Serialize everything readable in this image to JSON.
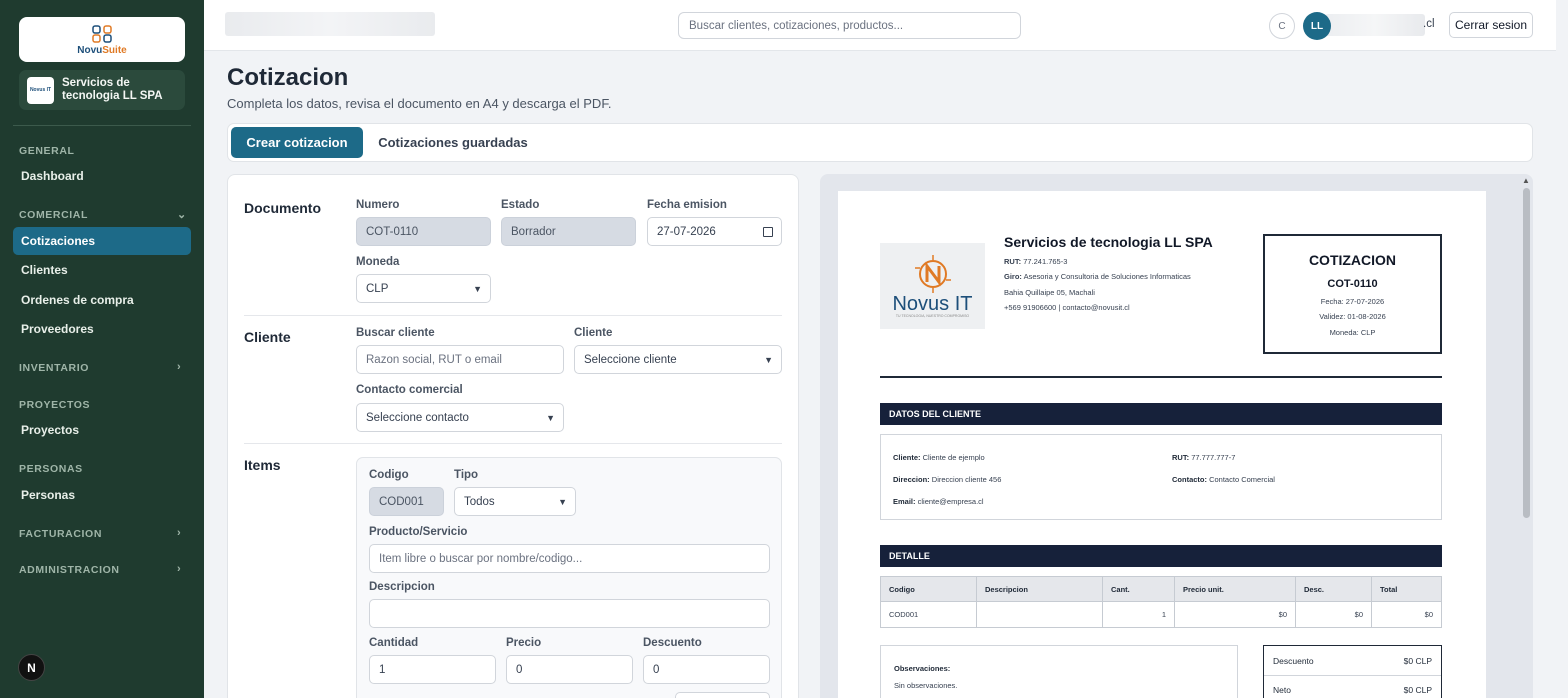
{
  "sidebar": {
    "brand": {
      "name_main": "Novu",
      "name_accent": "Suite"
    },
    "company": {
      "logo_text": "Novus IT",
      "name": "Servicios de tecnologia LL SPA"
    },
    "sections": [
      {
        "label": "GENERAL"
      },
      {
        "label": "COMERCIAL"
      },
      {
        "label": "INVENTARIO"
      },
      {
        "label": "PROYECTOS"
      },
      {
        "label": "PERSONAS"
      },
      {
        "label": "FACTURACION"
      },
      {
        "label": "ADMINISTRACION"
      }
    ],
    "items": {
      "dashboard": "Dashboard",
      "cotizaciones": "Cotizaciones",
      "clientes": "Clientes",
      "ordenes": "Ordenes de compra",
      "proveedores": "Proveedores",
      "proyectos": "Proyectos",
      "personas": "Personas"
    },
    "next_badge": "N"
  },
  "topbar": {
    "search_placeholder": "Buscar clientes, cotizaciones, productos...",
    "theme_btn": "C",
    "avatar": "LL",
    "user_suffix": ".cl",
    "logout": "Cerrar sesion"
  },
  "page": {
    "title": "Cotizacion",
    "subtitle": "Completa los datos, revisa el documento en A4 y descarga el PDF.",
    "tabs": {
      "create": "Crear cotizacion",
      "saved": "Cotizaciones guardadas"
    }
  },
  "form": {
    "documento": {
      "section": "Documento",
      "numero_label": "Numero",
      "numero_value": "COT-0110",
      "estado_label": "Estado",
      "estado_value": "Borrador",
      "fecha_label": "Fecha emision",
      "fecha_value": "27-07-2026",
      "moneda_label": "Moneda",
      "moneda_value": "CLP"
    },
    "cliente": {
      "section": "Cliente",
      "buscar_label": "Buscar cliente",
      "buscar_placeholder": "Razon social, RUT o email",
      "cliente_label": "Cliente",
      "cliente_value": "Seleccione cliente",
      "contacto_label": "Contacto comercial",
      "contacto_value": "Seleccione contacto"
    },
    "items": {
      "section": "Items",
      "codigo_label": "Codigo",
      "codigo_value": "COD001",
      "tipo_label": "Tipo",
      "tipo_value": "Todos",
      "producto_label": "Producto/Servicio",
      "producto_placeholder": "Item libre o buscar por nombre/codigo...",
      "descripcion_label": "Descripcion",
      "descripcion_value": "",
      "cantidad_label": "Cantidad",
      "cantidad_value": "1",
      "precio_label": "Precio",
      "precio_value": "0",
      "descuento_label": "Descuento",
      "descuento_value": "0"
    }
  },
  "preview": {
    "logo_name": "Novus IT",
    "logo_tag": "TU TECNOLOGIA, NUESTRO COMPROMISO",
    "company": "Servicios de tecnologia LL SPA",
    "rut_label": "RUT:",
    "rut_value": "77.241.765-3",
    "giro_label": "Giro:",
    "giro_value": "Asesoria y Consultoria de Soluciones Informaticas",
    "address": "Bahia Quillaipe 05, Machali",
    "contact": "+569 91906600 | contacto@novusit.cl",
    "quote_title": "COTIZACION",
    "quote_number": "COT-0110",
    "quote_fecha": "Fecha: 27-07-2026",
    "quote_validez": "Validez: 01-08-2026",
    "quote_moneda": "Moneda: CLP",
    "client_band": "DATOS DEL CLIENTE",
    "client": {
      "cliente_label": "Cliente:",
      "cliente_value": "Cliente de ejemplo",
      "rut_label": "RUT:",
      "rut_value": "77.777.777-7",
      "direccion_label": "Direccion:",
      "direccion_value": "Direccion cliente 456",
      "contacto_label": "Contacto:",
      "contacto_value": "Contacto Comercial",
      "email_label": "Email:",
      "email_value": "cliente@empresa.cl"
    },
    "detail_band": "DETALLE",
    "table": {
      "headers": [
        "Codigo",
        "Descripcion",
        "Cant.",
        "Precio unit.",
        "Desc.",
        "Total"
      ],
      "row": [
        "COD001",
        "",
        "1",
        "$0",
        "$0",
        "$0"
      ]
    },
    "obs_title": "Observaciones:",
    "obs_text": "Sin observaciones.",
    "totals": {
      "descuento_label": "Descuento",
      "descuento_value": "$0 CLP",
      "neto_label": "Neto",
      "neto_value": "$0 CLP"
    }
  }
}
